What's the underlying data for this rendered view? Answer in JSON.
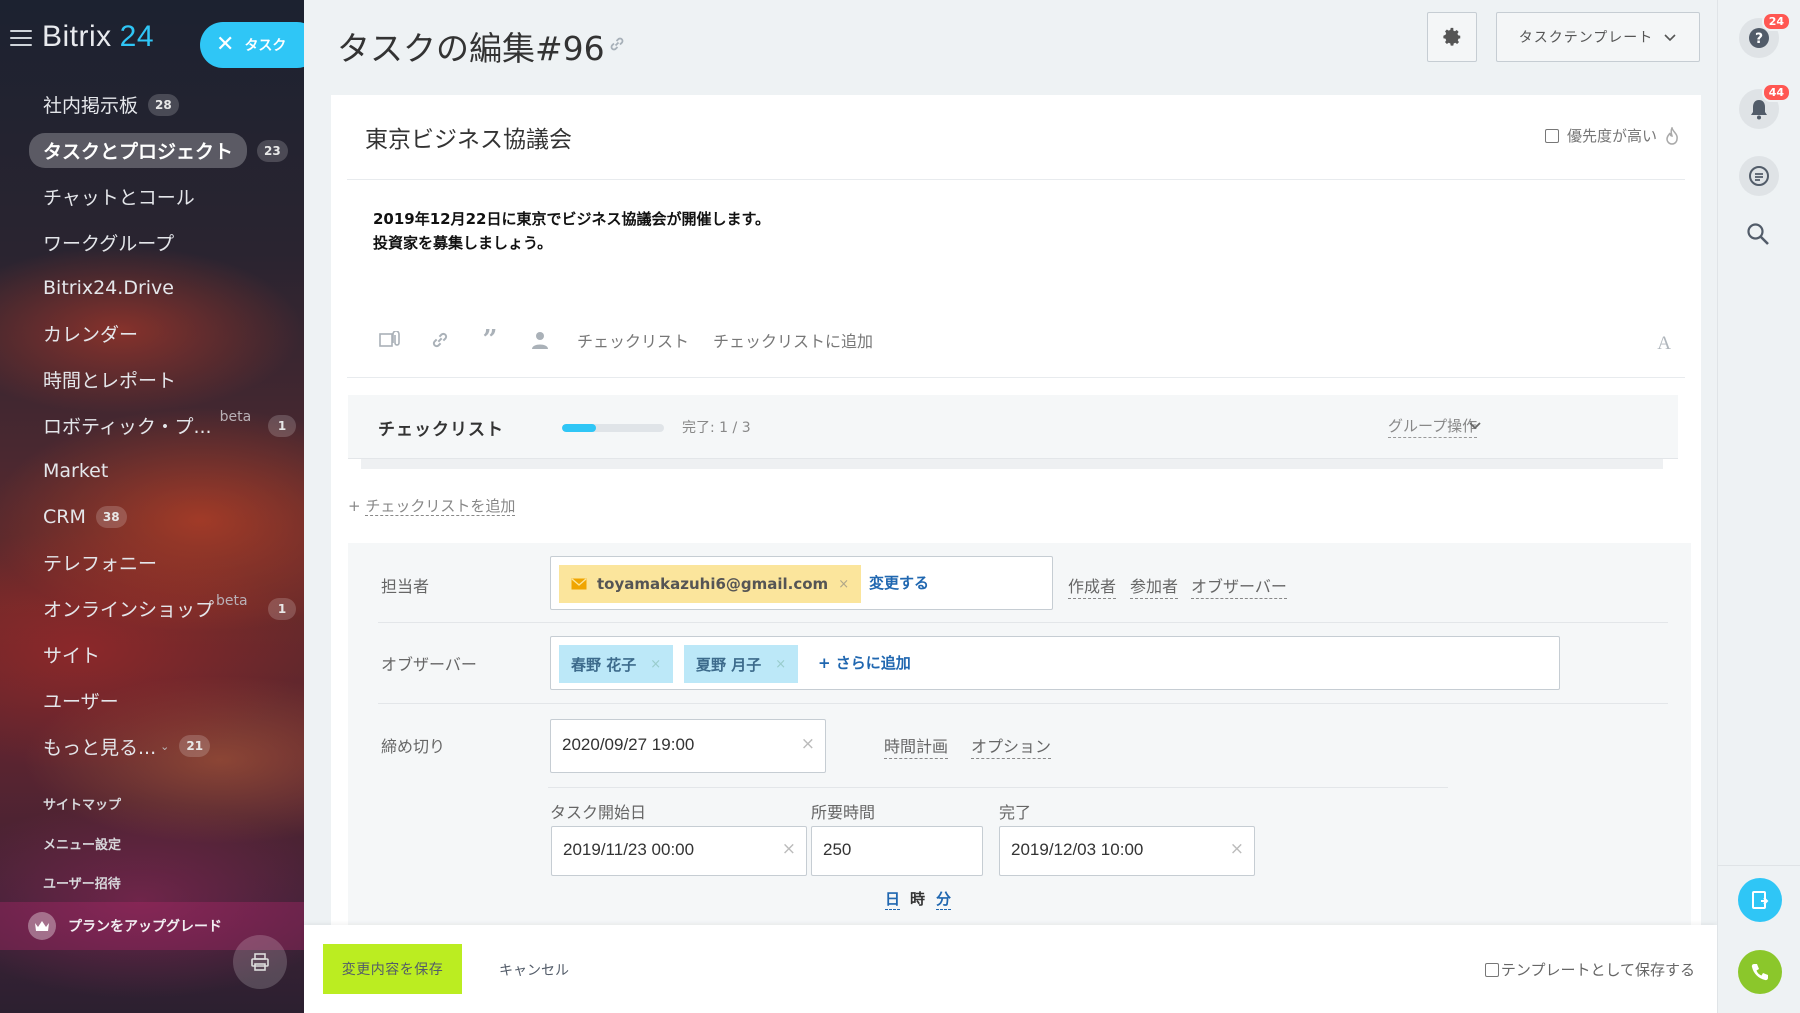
{
  "sidebar": {
    "logo_name": "Bitrix",
    "logo_num": "24",
    "task_pill_label": "タスク",
    "items": [
      {
        "label": "社内掲示板",
        "count": "28"
      },
      {
        "label": "タスクとプロジェクト",
        "count": "23"
      },
      {
        "label": "チャットとコール",
        "count": ""
      },
      {
        "label": "ワークグループ",
        "count": ""
      },
      {
        "label": "Bitrix24.Drive",
        "count": ""
      },
      {
        "label": "カレンダー",
        "count": ""
      },
      {
        "label": "時間とレポート",
        "count": ""
      },
      {
        "label": "ロボティック・プ...",
        "count": "1",
        "beta": "beta"
      },
      {
        "label": "Market",
        "count": ""
      },
      {
        "label": "CRM",
        "count": "38"
      },
      {
        "label": "テレフォニー",
        "count": ""
      },
      {
        "label": "オンラインショップ",
        "count": "1",
        "beta": "beta"
      },
      {
        "label": "サイト",
        "count": ""
      },
      {
        "label": "ユーザー",
        "count": ""
      },
      {
        "label": "もっと見る...",
        "count": "21"
      }
    ],
    "small_links": [
      "サイトマップ",
      "メニュー設定",
      "ユーザー招待"
    ],
    "upgrade_label": "プランをアップグレード"
  },
  "header": {
    "title": "タスクの編集#96",
    "template_button": "タスクテンプレート"
  },
  "task": {
    "title": "東京ビジネス協議会",
    "priority_label": "優先度が高い",
    "description_line1": "2019年12月22日に東京でビジネス協議会が開催します。",
    "description_line2": "投資家を募集しましょう。"
  },
  "toolbar": {
    "checklist": "チェックリスト",
    "add_to_checklist": "チェックリストに追加",
    "font_icon": "A"
  },
  "checklist": {
    "title": "チェックリスト",
    "progress": 0.33,
    "done_text": "完了: 1 / 3",
    "group_action": "グループ操作",
    "add_label": "+ ",
    "add_link": "チェックリストを追加"
  },
  "form": {
    "assignee_label": "担当者",
    "assignee_email": "toyamakazuhi6@gmail.com",
    "change_link": "変更する",
    "role_links": [
      "作成者",
      "参加者",
      "オブザーバー"
    ],
    "observer_label": "オブザーバー",
    "observers": [
      "春野 花子",
      "夏野 月子"
    ],
    "add_more": "+ さらに追加",
    "deadline_label": "締め切り",
    "deadline_value": "2020/09/27 19:00",
    "time_planning": "時間計画",
    "options": "オプション",
    "start_label": "タスク開始日",
    "start_value": "2019/11/23 00:00",
    "duration_label": "所要時間",
    "duration_value": "250",
    "end_label": "完了",
    "end_value": "2019/12/03 10:00",
    "units": [
      "日",
      "時",
      "分"
    ],
    "clear_x": "×",
    "tag_x": "×"
  },
  "footer": {
    "save": "変更内容を保存",
    "cancel": "キャンセル",
    "save_template": "テンプレートとして保存する"
  },
  "rightbar": {
    "help_badge": "24",
    "notif_badge": "44"
  },
  "colors": {
    "accent": "#2fc6f6",
    "save_green": "#bbed21",
    "badge_red": "#ff5752",
    "link_blue": "#2067b0"
  },
  "icons": [
    "hamburger-icon",
    "close-icon",
    "link-icon",
    "gear-icon",
    "chevron-down-icon",
    "fire-icon",
    "attach-icon",
    "quote-icon",
    "user-icon",
    "mail-icon",
    "crown-icon",
    "help-icon",
    "bell-icon",
    "chat-icon",
    "search-icon",
    "phone-icon"
  ]
}
